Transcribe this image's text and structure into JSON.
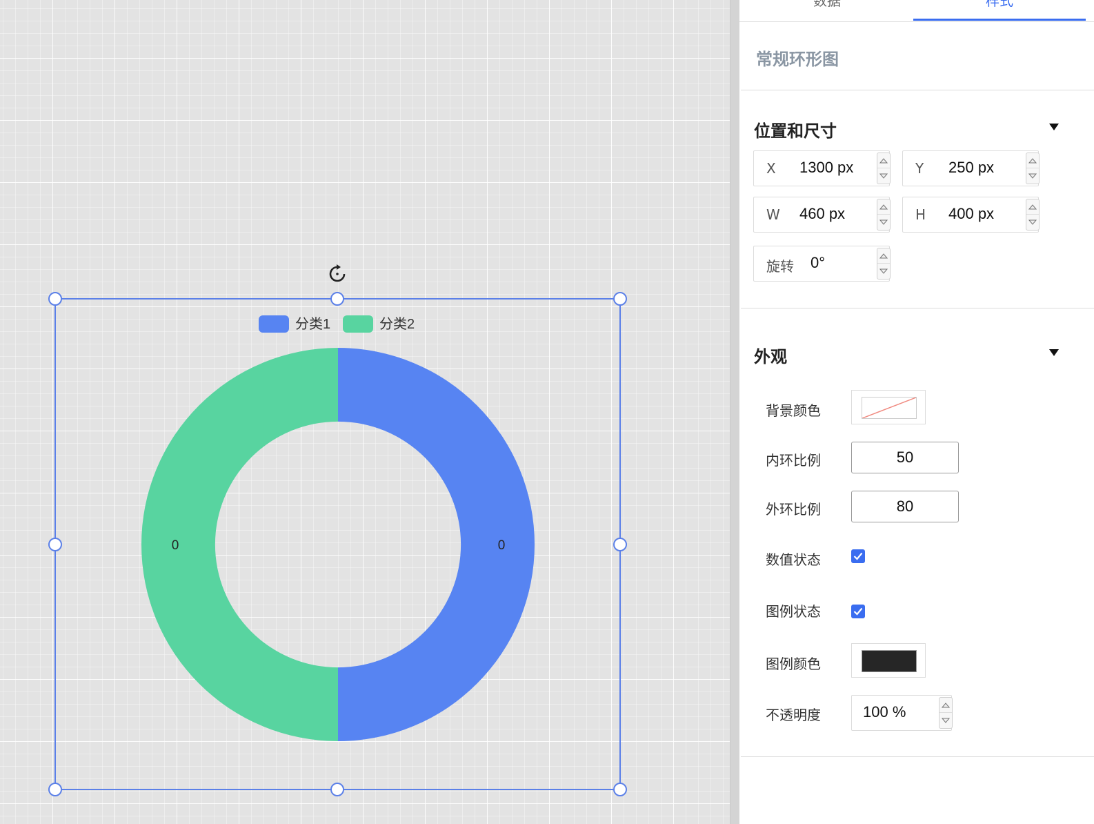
{
  "panel": {
    "tabs": [
      "数据",
      "样式"
    ],
    "active_tab": "样式",
    "component_name": "常规环形图",
    "position_size": {
      "title": "位置和尺寸",
      "x": {
        "label": "X",
        "value": "1300 px"
      },
      "y": {
        "label": "Y",
        "value": "250 px"
      },
      "w": {
        "label": "W",
        "value": "460 px"
      },
      "h": {
        "label": "H",
        "value": "400 px"
      },
      "rotation": {
        "label": "旋转",
        "value": "0°"
      }
    },
    "appearance": {
      "title": "外观",
      "bg_color_label": "背景颜色",
      "inner_ratio_label": "内环比例",
      "inner_ratio_value": "50",
      "outer_ratio_label": "外环比例",
      "outer_ratio_value": "80",
      "value_state_label": "数值状态",
      "value_state_checked": true,
      "legend_state_label": "图例状态",
      "legend_state_checked": true,
      "legend_color_label": "图例颜色",
      "legend_color": "#262626",
      "opacity_label": "不透明度",
      "opacity_value": "100 %"
    }
  },
  "colors": {
    "accent": "#3a6df0",
    "series1": "#5784f2",
    "series2": "#58d4a0",
    "selection": "#5b80e8"
  },
  "chart_data": {
    "type": "pie",
    "donut": true,
    "categories": [
      "分类1",
      "分类2"
    ],
    "values": [
      0,
      0
    ],
    "data_labels": [
      "0",
      "0"
    ],
    "legend": "top-center"
  }
}
